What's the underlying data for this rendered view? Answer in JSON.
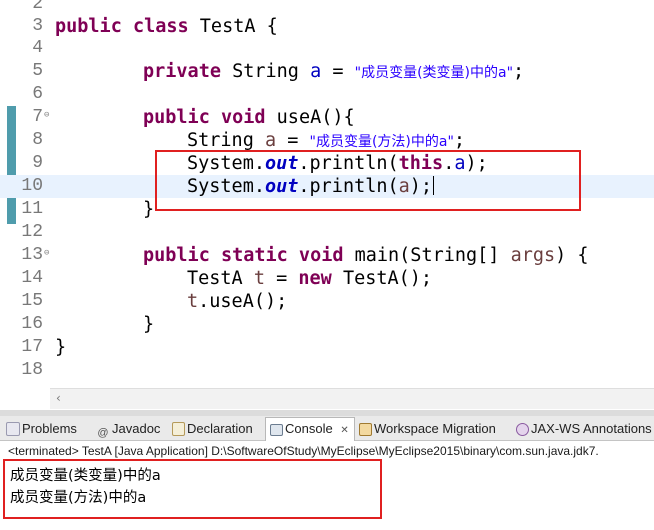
{
  "editor": {
    "lines": [
      {
        "num": "2"
      },
      {
        "num": "3",
        "t1": "public class",
        "t2": " TestA {"
      },
      {
        "num": "4"
      },
      {
        "num": "5",
        "kw": "private",
        "t1": " String ",
        "var": "a",
        "t2": " = ",
        "str": "\"成员变量(类变量)中的a\"",
        "end": ";"
      },
      {
        "num": "6"
      },
      {
        "num": "7",
        "kw": "public void",
        "t1": " useA(){"
      },
      {
        "num": "8",
        "t1": "String ",
        "var": "a",
        "t2": " = ",
        "str": "\"成员变量(方法)中的a\"",
        "end": ";"
      },
      {
        "num": "9",
        "t1": "System.",
        "fld": "out",
        "t2": ".println(",
        "kw": "this",
        "t3": ".",
        "var": "a",
        "end": ");"
      },
      {
        "num": "10",
        "t1": "System.",
        "fld": "out",
        "t2": ".println(",
        "var": "a",
        "end": ");"
      },
      {
        "num": "11",
        "t1": "}"
      },
      {
        "num": "12"
      },
      {
        "num": "13",
        "kw": "public static void",
        "t1": " main(String[] ",
        "var": "args",
        "t2": ") {"
      },
      {
        "num": "14",
        "t1": "TestA ",
        "var": "t",
        "t2": " = ",
        "kw": "new",
        "t3": " TestA();"
      },
      {
        "num": "15",
        "var": "t",
        "t1": ".useA();"
      },
      {
        "num": "16",
        "t1": "}"
      },
      {
        "num": "17",
        "t1": "}"
      },
      {
        "num": "18"
      }
    ]
  },
  "tabs": [
    {
      "label": "Problems",
      "icon": "problems-icon"
    },
    {
      "label": "Javadoc",
      "icon": "at-icon"
    },
    {
      "label": "Declaration",
      "icon": "declaration-icon"
    },
    {
      "label": "Console",
      "icon": "console-icon",
      "close": "✕"
    },
    {
      "label": "Workspace Migration",
      "icon": "migration-icon"
    },
    {
      "label": "JAX-WS Annotations",
      "icon": "jaxws-icon"
    }
  ],
  "console": {
    "header": "<terminated> TestA [Java Application] D:\\SoftwareOfStudy\\MyEclipse\\MyEclipse2015\\binary\\com.sun.java.jdk7.",
    "output": [
      "成员变量(类变量)中的a",
      "成员变量(方法)中的a"
    ]
  },
  "colors": {
    "keyword": "#7f0055",
    "string": "#2a00ff",
    "field": "#0000c0",
    "highlight_box": "#e02020",
    "current_line": "#e8f2fe"
  }
}
